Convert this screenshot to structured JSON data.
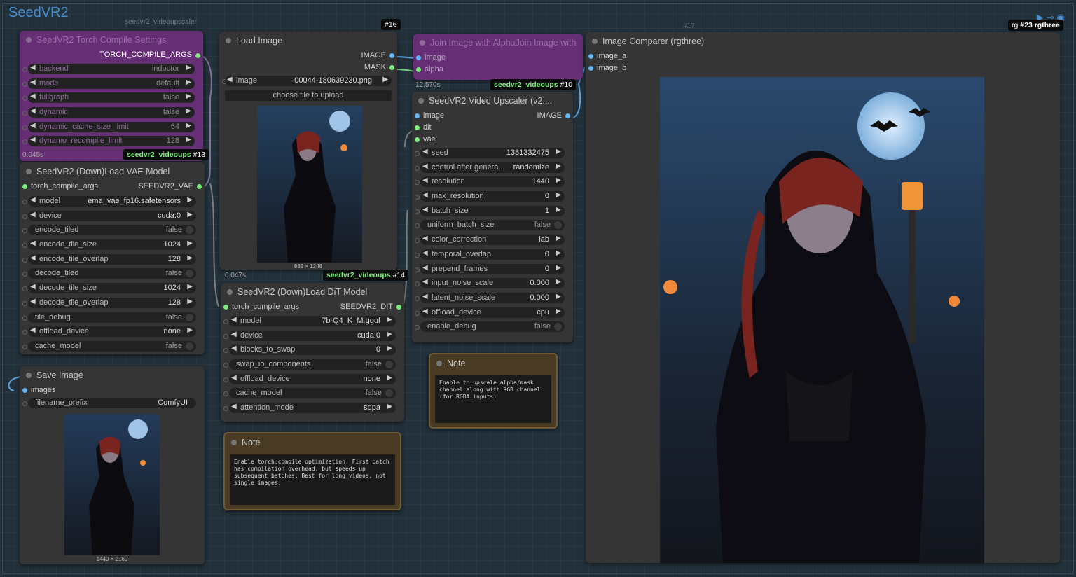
{
  "group": {
    "title": "SeedVR2"
  },
  "group_header_labels": {
    "a": "seedvr2_videoupscaler",
    "b": "#16",
    "c": "#17"
  },
  "nodes": {
    "torch_compile": {
      "title": "SeedVR2 Torch Compile Settings",
      "output": "TORCH_COMPILE_ARGS",
      "widgets": [
        {
          "label": "backend",
          "value": "inductor"
        },
        {
          "label": "mode",
          "value": "default"
        },
        {
          "label": "fullgraph",
          "value": "false"
        },
        {
          "label": "dynamic",
          "value": "false"
        },
        {
          "label": "dynamic_cache_size_limit",
          "value": "64"
        },
        {
          "label": "dynamo_recompile_limit",
          "value": "128"
        }
      ],
      "time": "0.045s",
      "badge_name": "seedvr2_videoups",
      "badge_id": "#13"
    },
    "vae": {
      "title": "SeedVR2 (Down)Load VAE Model",
      "input": "torch_compile_args",
      "output": "SEEDVR2_VAE",
      "widgets": [
        {
          "label": "model",
          "value": "ema_vae_fp16.safetensors"
        },
        {
          "label": "device",
          "value": "cuda:0"
        },
        {
          "label": "encode_tiled",
          "value": "false"
        },
        {
          "label": "encode_tile_size",
          "value": "1024"
        },
        {
          "label": "encode_tile_overlap",
          "value": "128"
        },
        {
          "label": "decode_tiled",
          "value": "false"
        },
        {
          "label": "decode_tile_size",
          "value": "1024"
        },
        {
          "label": "decode_tile_overlap",
          "value": "128"
        },
        {
          "label": "tile_debug",
          "value": "false"
        },
        {
          "label": "offload_device",
          "value": "none"
        },
        {
          "label": "cache_model",
          "value": "false"
        }
      ]
    },
    "save": {
      "title": "Save Image",
      "input": "images",
      "widget_label": "filename_prefix",
      "widget_value": "ComfyUI",
      "caption": "1440 × 2160"
    },
    "load_image": {
      "title": "Load Image",
      "out1": "IMAGE",
      "out2": "MASK",
      "image_label": "image",
      "image_value": "00044-180639230.png",
      "upload_label": "choose file to upload",
      "caption": "832 × 1248",
      "time": "0.047s",
      "badge_name": "seedvr2_videoups",
      "badge_id": "#14"
    },
    "dit": {
      "title": "SeedVR2 (Down)Load DiT Model",
      "input": "torch_compile_args",
      "output": "SEEDVR2_DIT",
      "widgets": [
        {
          "label": "model",
          "value": "7b-Q4_K_M.gguf"
        },
        {
          "label": "device",
          "value": "cuda:0"
        },
        {
          "label": "blocks_to_swap",
          "value": "0"
        },
        {
          "label": "swap_io_components",
          "value": "false"
        },
        {
          "label": "offload_device",
          "value": "none"
        },
        {
          "label": "cache_model",
          "value": "false"
        },
        {
          "label": "attention_mode",
          "value": "sdpa"
        }
      ]
    },
    "note1": {
      "title": "Note",
      "text": "Enable torch.compile optimization. First batch\nhas compilation overhead, but speeds up\nsubsequent batches. Best for long videos, not\nsingle images."
    },
    "join": {
      "title": "Join Image with AlphaJoin Image with",
      "in1": "image",
      "in2": "alpha",
      "time": "12.570s",
      "badge_name": "seedvr2_videoups",
      "badge_id": "#10"
    },
    "upscaler": {
      "title": "SeedVR2 Video Upscaler (v2....",
      "in1": "image",
      "out1": "IMAGE",
      "in2": "dit",
      "in3": "vae",
      "widgets": [
        {
          "label": "seed",
          "value": "1381332475"
        },
        {
          "label": "control after genera...",
          "value": "randomize"
        },
        {
          "label": "resolution",
          "value": "1440"
        },
        {
          "label": "max_resolution",
          "value": "0"
        },
        {
          "label": "batch_size",
          "value": "1"
        },
        {
          "label": "uniform_batch_size",
          "value": "false"
        },
        {
          "label": "color_correction",
          "value": "lab"
        },
        {
          "label": "temporal_overlap",
          "value": "0"
        },
        {
          "label": "prepend_frames",
          "value": "0"
        },
        {
          "label": "input_noise_scale",
          "value": "0.000"
        },
        {
          "label": "latent_noise_scale",
          "value": "0.000"
        },
        {
          "label": "offload_device",
          "value": "cpu"
        },
        {
          "label": "enable_debug",
          "value": "false"
        }
      ]
    },
    "note2": {
      "title": "Note",
      "text": "Enable to upscale alpha/mask\nchannel along with RGB channel\n(for RGBA inputs)"
    },
    "comparer": {
      "title": "Image Comparer (rgthree)",
      "in1": "image_a",
      "in2": "image_b",
      "badge_prefix": "rg",
      "badge_text": "#23 rgthree"
    }
  },
  "colors": {
    "image_socket": "#64b5f6",
    "green_socket": "#7cf07c",
    "purple_node": "#662e75",
    "group_title": "#4a8fd0"
  }
}
